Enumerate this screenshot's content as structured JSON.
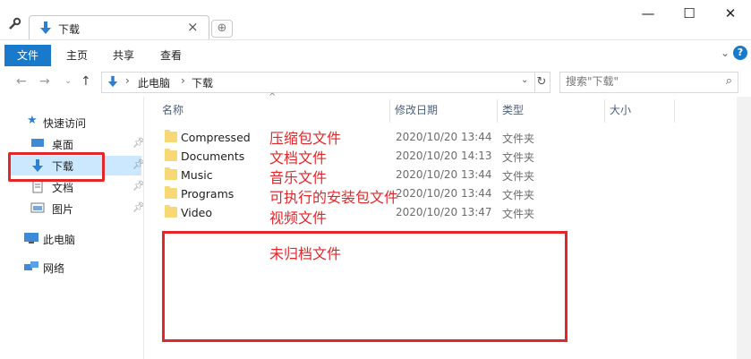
{
  "tab": {
    "title": "下载"
  },
  "ribbon": {
    "file": "文件",
    "home": "主页",
    "share": "共享",
    "view": "查看"
  },
  "address": {
    "crumbs": [
      "此电脑",
      "下载"
    ]
  },
  "search": {
    "placeholder": "搜索\"下载\""
  },
  "nav": {
    "quick_access": "快速访问",
    "items": [
      "桌面",
      "下载",
      "文档",
      "图片"
    ],
    "this_pc": "此电脑",
    "network": "网络"
  },
  "columns": {
    "name": "名称",
    "date": "修改日期",
    "type": "类型",
    "size": "大小"
  },
  "files": [
    {
      "name": "Compressed",
      "date": "2020/10/20 13:44",
      "type": "文件夹"
    },
    {
      "name": "Documents",
      "date": "2020/10/20 14:13",
      "type": "文件夹"
    },
    {
      "name": "Music",
      "date": "2020/10/20 13:44",
      "type": "文件夹"
    },
    {
      "name": "Programs",
      "date": "2020/10/20 13:44",
      "type": "文件夹"
    },
    {
      "name": "Video",
      "date": "2020/10/20 13:47",
      "type": "文件夹"
    }
  ],
  "annotations": [
    "压缩包文件",
    "文档文件",
    "音乐文件",
    "可执行的安装包文件",
    "视频文件",
    "未归档文件"
  ],
  "colors": {
    "accent": "#1979ca",
    "selection": "#cce8ff",
    "annotation": "#e3262a",
    "folder": "#f8d775"
  }
}
